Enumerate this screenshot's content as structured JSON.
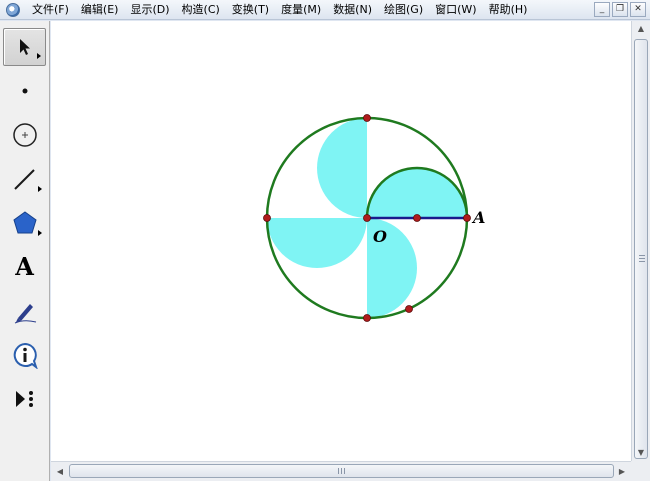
{
  "menu": {
    "items": [
      {
        "label": "文件(F)"
      },
      {
        "label": "编辑(E)"
      },
      {
        "label": "显示(D)"
      },
      {
        "label": "构造(C)"
      },
      {
        "label": "变换(T)"
      },
      {
        "label": "度量(M)"
      },
      {
        "label": "数据(N)"
      },
      {
        "label": "绘图(G)"
      },
      {
        "label": "窗口(W)"
      },
      {
        "label": "帮助(H)"
      }
    ]
  },
  "window_buttons": {
    "minimize": "_",
    "restore": "❐",
    "close": "✕"
  },
  "toolbox": {
    "tools": [
      {
        "name": "select-arrow-tool",
        "icon": "arrow-icon"
      },
      {
        "name": "point-tool",
        "icon": "point-icon"
      },
      {
        "name": "compass-tool",
        "icon": "circle-icon"
      },
      {
        "name": "straightedge-tool",
        "icon": "line-icon"
      },
      {
        "name": "polygon-tool",
        "icon": "pentagon-icon"
      },
      {
        "name": "text-tool",
        "icon": "text-A-icon",
        "glyph": "A"
      },
      {
        "name": "marker-tool",
        "icon": "pen-icon"
      },
      {
        "name": "information-tool",
        "icon": "info-icon"
      },
      {
        "name": "custom-tool",
        "icon": "play-dots-icon"
      }
    ]
  },
  "canvas": {
    "labels": {
      "point_O": "O",
      "point_A": "A"
    },
    "colors": {
      "circle": "#1f7a1f",
      "fill": "#7ff4f4",
      "segment": "#1a1a8c",
      "point": "#b01c1c"
    }
  },
  "scrollbars": {
    "vertical": "visible",
    "horizontal": "visible"
  }
}
